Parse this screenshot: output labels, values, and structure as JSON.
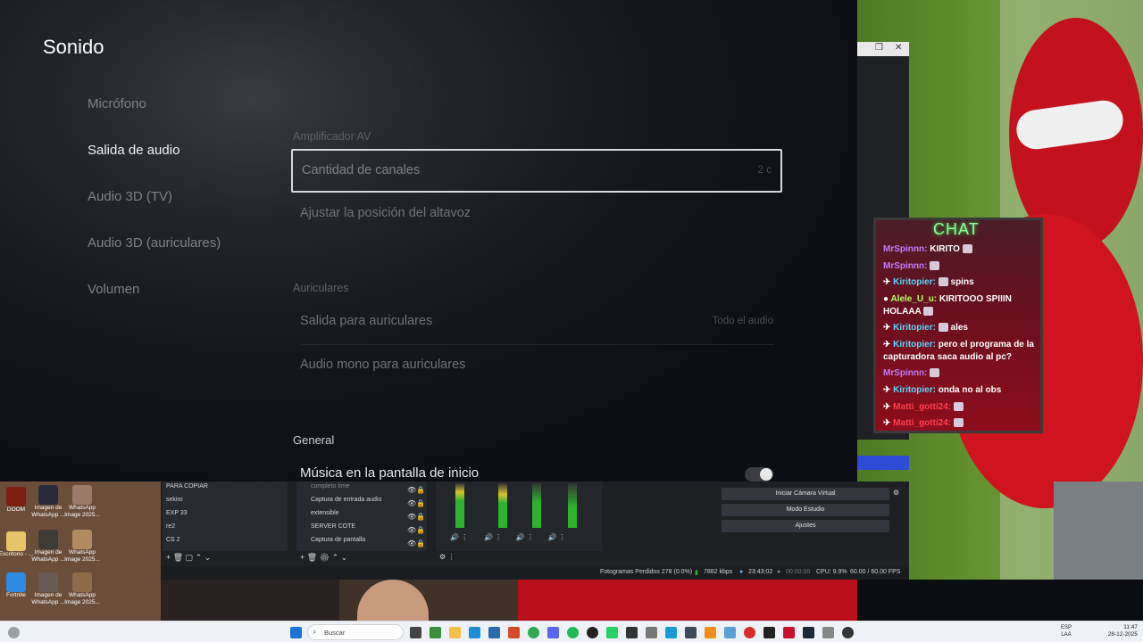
{
  "ps5": {
    "title": "Sonido",
    "nav": [
      "Micrófono",
      "Salida de audio",
      "Audio 3D (TV)",
      "Audio 3D (auriculares)",
      "Volumen"
    ],
    "active_nav": "Salida de audio",
    "sections": {
      "amplifier": "Amplificador AV",
      "headphones": "Auriculares",
      "general": "General"
    },
    "rows": {
      "channels": {
        "label": "Cantidad de canales",
        "value": "2 c"
      },
      "speaker_position": {
        "label": "Ajustar la posición del altavoz"
      },
      "headphone_output": {
        "label": "Salida para auriculares",
        "value": "Todo el audio"
      },
      "mono_audio": {
        "label": "Audio mono para auriculares"
      },
      "home_music": {
        "label": "Música en la pantalla de inicio"
      }
    }
  },
  "chat": {
    "title": "CHAT",
    "messages": [
      {
        "user": "MrSpinnn:",
        "text": "KIRITO",
        "color": "purple"
      },
      {
        "user": "MrSpinnn:",
        "text": "",
        "color": "purple"
      },
      {
        "user": "Kiritopier:",
        "text": "spins",
        "color": "cyan"
      },
      {
        "user": "Alele_U_u:",
        "text": "KIRITOOO SPIIIN HOLAAA",
        "color": "lime"
      },
      {
        "user": "Kiritopier:",
        "text": "ales",
        "color": "cyan"
      },
      {
        "user": "Kiritopier:",
        "text": "pero el programa de la capturadora saca audio al pc?",
        "color": "cyan"
      },
      {
        "user": "MrSpinnn:",
        "text": "",
        "color": "purple"
      },
      {
        "user": "Kiritopier:",
        "text": "onda no al obs",
        "color": "cyan"
      },
      {
        "user": "Matti_gotti24:",
        "text": "",
        "color": "red"
      },
      {
        "user": "Matti_gotti24:",
        "text": "",
        "color": "red"
      }
    ]
  },
  "desktop": {
    "icons": [
      "DOOM",
      "Imagen de WhatsApp ...",
      "WhatsApp Image 2025...",
      "Escritorio - ...",
      "Imagen de WhatsApp ...",
      "WhatsApp Image 2025...",
      "Fortnite",
      "Imagen de WhatsApp ...",
      "WhatsApp Image 2025..."
    ]
  },
  "obs": {
    "scenes": [
      "PARA COPIAR",
      "sekiro",
      "EXP 33",
      "re2",
      "CS 2"
    ],
    "sources": [
      "completo time",
      "Captura de entrada audio",
      "extensible",
      "SERVER COTE",
      "Captura de pantalla"
    ],
    "controls": [
      "Iniciar Cámara Virtual",
      "Modo Estudio",
      "Ajustes"
    ],
    "status": {
      "dropped": "Fotogramas Perdidos 278 (0.0%)",
      "bitrate": "7882 kbps",
      "live_time": "23:43:02",
      "rec_time": "00:00:00",
      "cpu": "CPU: 9.9%",
      "fps": "60.00 / 60.00 FPS"
    }
  },
  "taskbar": {
    "search_placeholder": "Buscar",
    "lang_top": "ESP",
    "lang_bottom": "LAA",
    "time": "11:47",
    "date": "28-12-2025"
  },
  "window_strip": {
    "restore": "❐",
    "close": "✕"
  }
}
